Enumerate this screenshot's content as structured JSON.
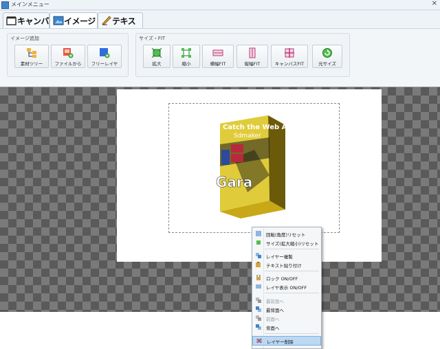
{
  "window": {
    "title": "メインメニュー",
    "close_glyph": "✕"
  },
  "tabs": [
    {
      "label": "キャンバス",
      "icon": "canvas-icon"
    },
    {
      "label": "イメージ",
      "icon": "image-icon"
    },
    {
      "label": "テキスト",
      "icon": "text-pen-icon"
    }
  ],
  "ribbon": {
    "group_add": {
      "label": "イメージ追加",
      "buttons": [
        {
          "label": "素材ツリー",
          "icon": "material-tree-icon"
        },
        {
          "label": "ファイルから",
          "icon": "file-add-icon"
        },
        {
          "label": "フリーレイヤ",
          "icon": "free-layer-icon"
        }
      ]
    },
    "group_size": {
      "label": "サイズ・FIT",
      "buttons": [
        {
          "label": "拡大",
          "icon": "enlarge-icon"
        },
        {
          "label": "縮小",
          "icon": "shrink-icon"
        },
        {
          "label": "横幅FIT",
          "icon": "fit-width-icon"
        },
        {
          "label": "縦幅FIT",
          "icon": "fit-height-icon"
        },
        {
          "label": "キャンバスFIT",
          "icon": "fit-canvas-icon"
        },
        {
          "label": "元サイズ",
          "icon": "original-size-icon"
        }
      ]
    }
  },
  "product": {
    "line1": "Catch the Web Ads",
    "line2": "Sdmaker",
    "brand": "Gara"
  },
  "context_menu": {
    "items": [
      {
        "label": "回転(角度)リセット",
        "enabled": true,
        "icon": "rotate-reset-icon"
      },
      {
        "label": "サイズ(拡大縮小)リセット",
        "enabled": true,
        "icon": "size-reset-icon"
      },
      {
        "label": "レイヤー複製",
        "enabled": true,
        "icon": "layer-duplicate-icon"
      },
      {
        "label": "テキスト貼り付け",
        "enabled": true,
        "icon": "paste-text-icon"
      },
      {
        "label": "ロック ON/OFF",
        "enabled": true,
        "icon": "lock-icon"
      },
      {
        "label": "レイヤ表示 ON/OFF",
        "enabled": true,
        "icon": "layer-visibility-icon"
      },
      {
        "label": "最前面へ",
        "enabled": false,
        "icon": "bring-to-front-icon"
      },
      {
        "label": "最背面へ",
        "enabled": true,
        "icon": "send-to-back-icon"
      },
      {
        "label": "前面へ",
        "enabled": false,
        "icon": "bring-forward-icon"
      },
      {
        "label": "背面へ",
        "enabled": true,
        "icon": "send-backward-icon"
      },
      {
        "label": "レイヤー削除",
        "enabled": true,
        "highlighted": true,
        "icon": "delete-layer-icon"
      }
    ]
  },
  "colors": {
    "accent": "#3f86c8",
    "highlight": "#bcd8f2",
    "product_yellow": "#d8c21a",
    "product_red": "#b8293b",
    "product_blue": "#2b4a9c"
  }
}
